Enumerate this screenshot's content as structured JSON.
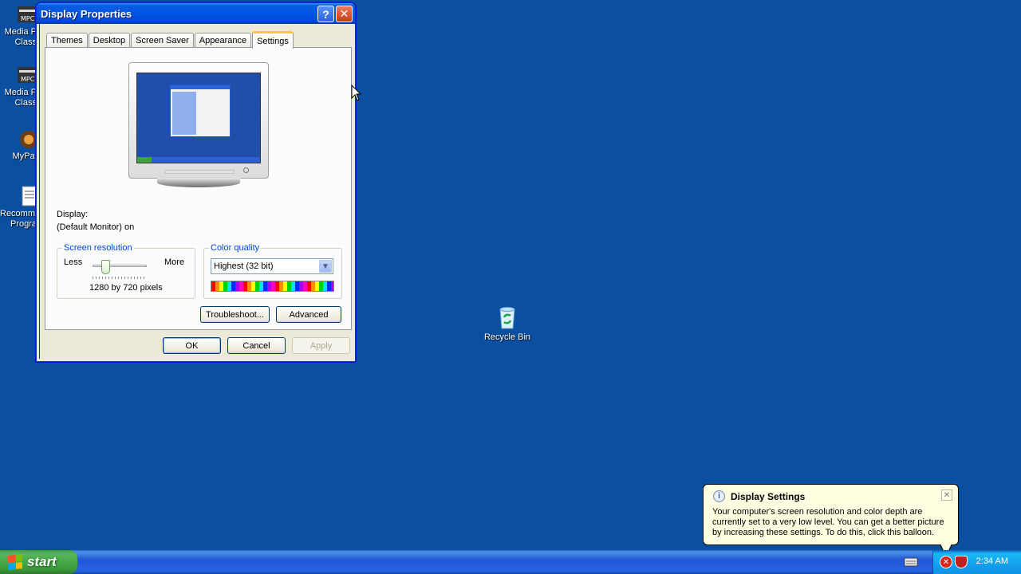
{
  "desktop": {
    "left_icons": [
      {
        "label1": "Media P",
        "label2": "Class"
      },
      {
        "label1": "Media P",
        "label2": "Class"
      },
      {
        "label1": "MyPal",
        "label2": ""
      },
      {
        "label1": "Recomme",
        "label2": "Progra"
      }
    ],
    "recycle_bin": {
      "label": "Recycle Bin"
    }
  },
  "window": {
    "title": "Display Properties",
    "help_glyph": "?",
    "close_glyph": "✕",
    "tabs": [
      {
        "label": "Themes"
      },
      {
        "label": "Desktop"
      },
      {
        "label": "Screen Saver"
      },
      {
        "label": "Appearance"
      },
      {
        "label": "Settings"
      }
    ],
    "active_tab": "Settings",
    "display_label": "Display:",
    "display_value": "(Default Monitor) on",
    "resolution": {
      "legend": "Screen resolution",
      "less": "Less",
      "more": "More",
      "value_text": "1280 by 720 pixels",
      "slider_position": 0.2
    },
    "color_quality": {
      "legend": "Color quality",
      "selected": "Highest (32 bit)"
    },
    "buttons": {
      "troubleshoot": "Troubleshoot...",
      "advanced": "Advanced",
      "ok": "OK",
      "cancel": "Cancel",
      "apply": "Apply"
    }
  },
  "balloon": {
    "title": "Display Settings",
    "info_glyph": "i",
    "close_glyph": "✕",
    "text": "Your computer's screen resolution and color depth are currently set to a very low level. You can get a better picture by increasing these settings. To do this, click this balloon."
  },
  "taskbar": {
    "start_label": "start",
    "clock": "2:34 AM"
  },
  "colors": {
    "desktop_bg": "#0a4fa0",
    "title_blue": "#0055e5",
    "start_green": "#3c9a3c",
    "legend_blue": "#0046d5",
    "balloon_bg": "#ffffe1"
  }
}
